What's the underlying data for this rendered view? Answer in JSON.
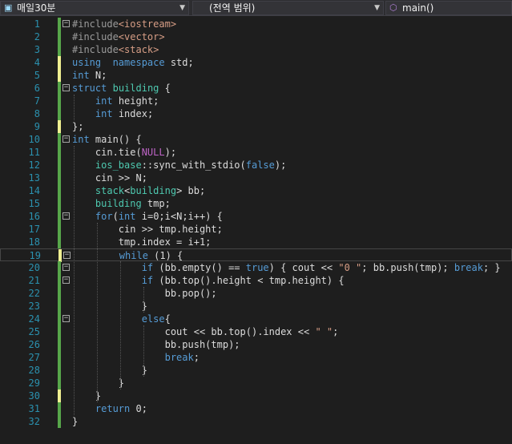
{
  "navbar": {
    "project": "매일30분",
    "scope": "(전역 범위)",
    "function": "main()"
  },
  "colors": {
    "background": "#1e1e1e",
    "line_number": "#2b91af",
    "keyword": "#569cd6",
    "string": "#d69d85",
    "type": "#4ec9b0",
    "macro": "#bd63c5",
    "number": "#b5cea8",
    "saved_change": "#57a64a",
    "unsaved_change": "#efef91"
  },
  "code_lines": [
    {
      "num": "1",
      "tokens": [
        [
          "pp",
          "#include"
        ],
        [
          "hdr",
          "<iostream>"
        ]
      ]
    },
    {
      "num": "2",
      "tokens": [
        [
          "pp",
          "#include"
        ],
        [
          "hdr",
          "<vector>"
        ]
      ]
    },
    {
      "num": "3",
      "tokens": [
        [
          "pp",
          "#include"
        ],
        [
          "hdr",
          "<stack>"
        ]
      ]
    },
    {
      "num": "4",
      "tokens": [
        [
          "kw",
          "using"
        ],
        [
          "",
          "  "
        ],
        [
          "kw",
          "namespace"
        ],
        [
          "",
          " std;"
        ]
      ]
    },
    {
      "num": "5",
      "tokens": [
        [
          "kw",
          "int"
        ],
        [
          "",
          " N;"
        ]
      ]
    },
    {
      "num": "6",
      "tokens": [
        [
          "kw",
          "struct"
        ],
        [
          "",
          " "
        ],
        [
          "ty",
          "building"
        ],
        [
          "",
          " {"
        ]
      ]
    },
    {
      "num": "7",
      "tokens": [
        [
          "",
          "    "
        ],
        [
          "kw",
          "int"
        ],
        [
          "",
          " height;"
        ]
      ]
    },
    {
      "num": "8",
      "tokens": [
        [
          "",
          "    "
        ],
        [
          "kw",
          "int"
        ],
        [
          "",
          " index;"
        ]
      ]
    },
    {
      "num": "9",
      "tokens": [
        [
          "",
          "};"
        ]
      ]
    },
    {
      "num": "10",
      "tokens": [
        [
          "kw",
          "int"
        ],
        [
          "",
          " main() {"
        ]
      ]
    },
    {
      "num": "11",
      "tokens": [
        [
          "",
          "    cin.tie("
        ],
        [
          "mac",
          "NULL"
        ],
        [
          "",
          ");"
        ]
      ]
    },
    {
      "num": "12",
      "tokens": [
        [
          "",
          "    "
        ],
        [
          "ty",
          "ios_base"
        ],
        [
          "",
          "::sync_with_stdio("
        ],
        [
          "kw",
          "false"
        ],
        [
          "",
          ");"
        ]
      ]
    },
    {
      "num": "13",
      "tokens": [
        [
          "",
          "    cin >> N;"
        ]
      ]
    },
    {
      "num": "14",
      "tokens": [
        [
          "",
          "    "
        ],
        [
          "ty",
          "stack"
        ],
        [
          "",
          "<"
        ],
        [
          "ty",
          "building"
        ],
        [
          "",
          "> bb;"
        ]
      ]
    },
    {
      "num": "15",
      "tokens": [
        [
          "",
          "    "
        ],
        [
          "ty",
          "building"
        ],
        [
          "",
          " tmp;"
        ]
      ]
    },
    {
      "num": "16",
      "tokens": [
        [
          "",
          "    "
        ],
        [
          "kw",
          "for"
        ],
        [
          "",
          "("
        ],
        [
          "kw",
          "int"
        ],
        [
          "",
          " i=0;i<N;i++) {"
        ]
      ]
    },
    {
      "num": "17",
      "tokens": [
        [
          "",
          "        cin >> tmp.height;"
        ]
      ]
    },
    {
      "num": "18",
      "tokens": [
        [
          "",
          "        tmp.index = i+1;"
        ]
      ]
    },
    {
      "num": "19",
      "tokens": [
        [
          "",
          "        "
        ],
        [
          "kw",
          "while"
        ],
        [
          "",
          " (1) {"
        ]
      ]
    },
    {
      "num": "20",
      "tokens": [
        [
          "",
          "            "
        ],
        [
          "kw",
          "if"
        ],
        [
          "",
          " (bb.empty() == "
        ],
        [
          "kw",
          "true"
        ],
        [
          "",
          ") { cout << "
        ],
        [
          "str",
          "\"0 \""
        ],
        [
          "",
          "; bb.push(tmp); "
        ],
        [
          "kw",
          "break"
        ],
        [
          "",
          "; }"
        ]
      ]
    },
    {
      "num": "21",
      "tokens": [
        [
          "",
          "            "
        ],
        [
          "kw",
          "if"
        ],
        [
          "",
          " (bb.top().height < tmp.height) {"
        ]
      ]
    },
    {
      "num": "22",
      "tokens": [
        [
          "",
          "                bb.pop();"
        ]
      ]
    },
    {
      "num": "23",
      "tokens": [
        [
          "",
          "            }"
        ]
      ]
    },
    {
      "num": "24",
      "tokens": [
        [
          "",
          "            "
        ],
        [
          "kw",
          "else"
        ],
        [
          "",
          "{"
        ]
      ]
    },
    {
      "num": "25",
      "tokens": [
        [
          "",
          "                cout << bb.top().index << "
        ],
        [
          "str",
          "\" \""
        ],
        [
          "",
          ";"
        ]
      ]
    },
    {
      "num": "26",
      "tokens": [
        [
          "",
          "                bb.push(tmp);"
        ]
      ]
    },
    {
      "num": "27",
      "tokens": [
        [
          "",
          "                "
        ],
        [
          "kw",
          "break"
        ],
        [
          "",
          ";"
        ]
      ]
    },
    {
      "num": "28",
      "tokens": [
        [
          "",
          "            }"
        ]
      ]
    },
    {
      "num": "29",
      "tokens": [
        [
          "",
          "        }"
        ]
      ]
    },
    {
      "num": "30",
      "tokens": [
        [
          "",
          "    }"
        ]
      ]
    },
    {
      "num": "31",
      "tokens": [
        [
          "",
          "    "
        ],
        [
          "kw",
          "return"
        ],
        [
          "",
          " 0;"
        ]
      ]
    },
    {
      "num": "32",
      "tokens": [
        [
          "",
          "}"
        ]
      ]
    }
  ],
  "fold_markers": {
    "1": "−",
    "6": "−",
    "10": "−",
    "16": "−",
    "19": "−",
    "20": "−",
    "21": "−",
    "24": "−"
  },
  "unsaved_lines": [
    "4",
    "5",
    "9",
    "19",
    "30"
  ],
  "current_line": "19"
}
